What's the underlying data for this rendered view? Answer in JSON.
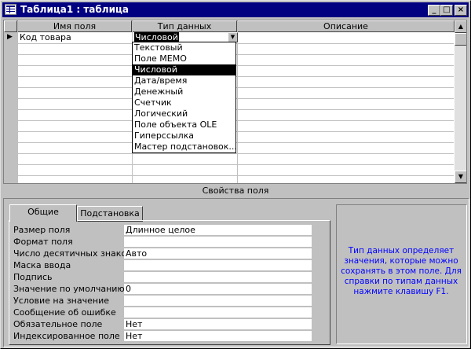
{
  "window": {
    "title": "Таблица1 : таблица",
    "buttons": {
      "minimize": "_",
      "maximize": "□",
      "close": "×"
    }
  },
  "grid": {
    "headers": [
      "Имя поля",
      "Тип данных",
      "Описание"
    ],
    "row1": {
      "name": "Код товара",
      "type": "Числовой",
      "description": ""
    },
    "row_indicator": "▶",
    "dropdown_arrow": "▼"
  },
  "dropdown": {
    "options": [
      "Текстовый",
      "Поле MEMO",
      "Числовой",
      "Дата/время",
      "Денежный",
      "Счетчик",
      "Логический",
      "Поле объекта OLE",
      "Гиперссылка",
      "Мастер подстановок..."
    ],
    "selected_index": 2
  },
  "properties": {
    "section_title": "Свойства поля",
    "tabs": [
      "Общие",
      "Подстановка"
    ],
    "active_tab": 0,
    "rows": [
      {
        "label": "Размер поля",
        "value": "Длинное целое"
      },
      {
        "label": "Формат поля",
        "value": ""
      },
      {
        "label": "Число десятичных знаков",
        "value": "Авто"
      },
      {
        "label": "Маска ввода",
        "value": ""
      },
      {
        "label": "Подпись",
        "value": ""
      },
      {
        "label": "Значение по умолчанию",
        "value": "0"
      },
      {
        "label": "Условие на значение",
        "value": ""
      },
      {
        "label": "Сообщение об ошибке",
        "value": ""
      },
      {
        "label": "Обязательное поле",
        "value": "Нет"
      },
      {
        "label": "Индексированное поле",
        "value": "Нет"
      }
    ]
  },
  "help": {
    "text": "Тип данных определяет значения, которые можно сохранять в этом поле.  Для справки по типам данных нажмите клавишу F1."
  },
  "colors": {
    "titlebar": "#000080",
    "help_text": "#0000ff",
    "face": "#c0c0c0"
  }
}
